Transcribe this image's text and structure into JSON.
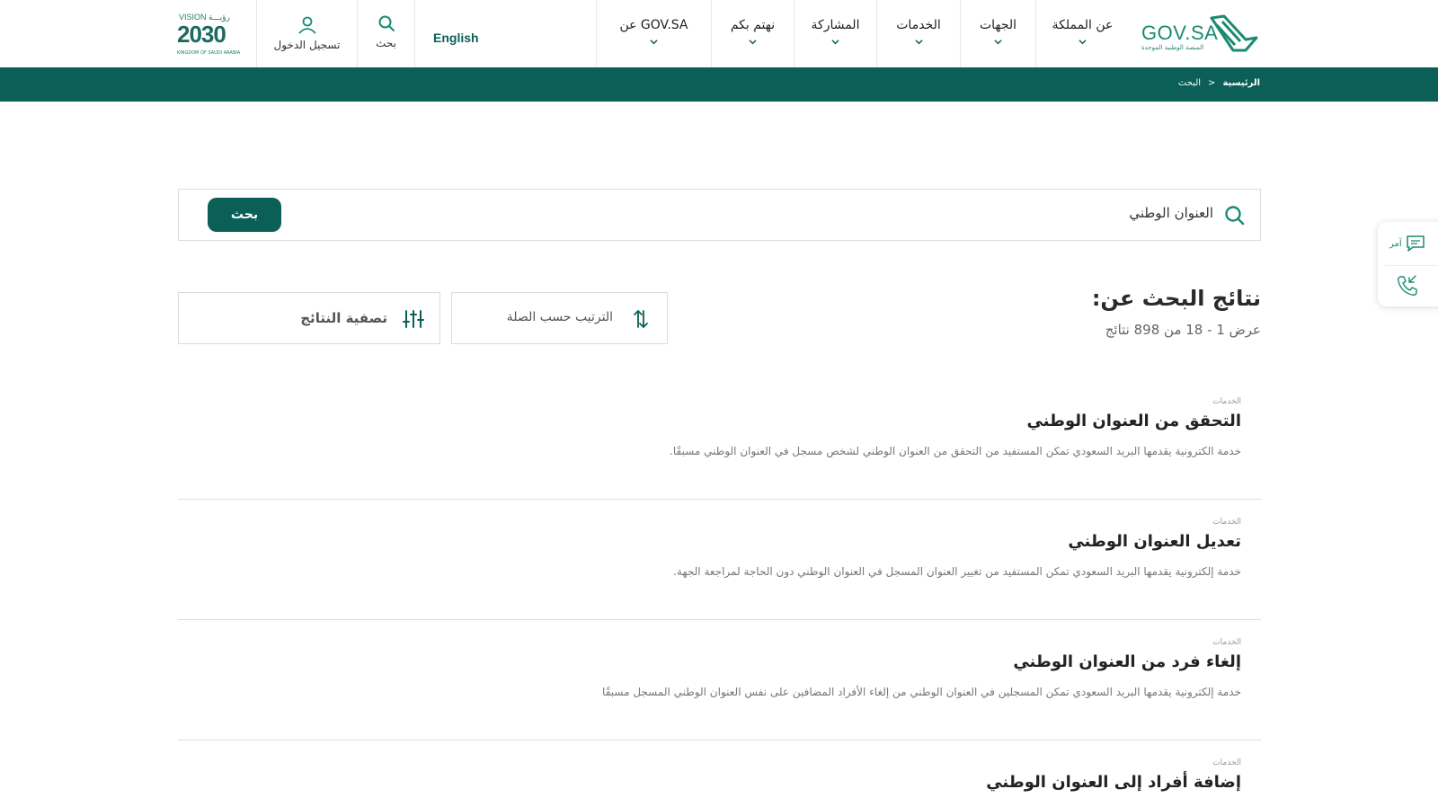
{
  "header": {
    "gov_logo": {
      "text": "GOV.SA",
      "sub": "المنصة الوطنية الموحدة"
    },
    "nav": [
      {
        "label": "عن المملكة"
      },
      {
        "label": "الجهات"
      },
      {
        "label": "الخدمات"
      },
      {
        "label": "المشاركة"
      },
      {
        "label": "نهتم بكم"
      },
      {
        "label": "عن GOV.SA"
      }
    ],
    "language": "English",
    "search_label": "بحث",
    "login_label": "تسجيل الدخول",
    "vision_logo": {
      "top": "VISION رؤيـــة",
      "year": "2030",
      "bottom": "KINGDOM OF SAUDI ARABIA"
    }
  },
  "breadcrumb": {
    "home": "الرئيسية",
    "separator": ">",
    "current": "البحث"
  },
  "search": {
    "query": "العنوان الوطني",
    "button": "بحث"
  },
  "results_header": {
    "title": "نتائج البحث عن:",
    "count": "عرض 1 - 18 من 898 نتائج",
    "sort_label": "الترتيب حسب الصلة",
    "filter_label": "تصفية النتائج"
  },
  "results": [
    {
      "category": "الخدمات",
      "title": "التحقق من العنوان الوطني",
      "description": "خدمة الكترونية يقدمها البريد السعودي تمكن المستفيد من التحقق من العنوان الوطني لشخص مسجل في العنوان الوطني مسبقًا."
    },
    {
      "category": "الخدمات",
      "title": "تعديل العنوان الوطني",
      "description": "خدمة إلكترونية يقدمها البريد السعودي تمكن المستفيد من تغيير العنوان المسجل في العنوان الوطني دون الحاجة لمراجعة الجهة."
    },
    {
      "category": "الخدمات",
      "title": "إلغاء فرد من العنوان الوطني",
      "description": "خدمة إلكترونية يقدمها البريد السعودي تمكن المسجلين في العنوان الوطني من إلغاء الأفراد المضافين على نفس العنوان الوطني المسجل مسبقًا"
    },
    {
      "category": "الخدمات",
      "title": "إضافة أفراد إلى العنوان الوطني",
      "description": ""
    }
  ],
  "side_widget": {
    "amer_label": "آمر"
  },
  "colors": {
    "primary": "#0b5f57",
    "accent": "#1b8a72"
  }
}
